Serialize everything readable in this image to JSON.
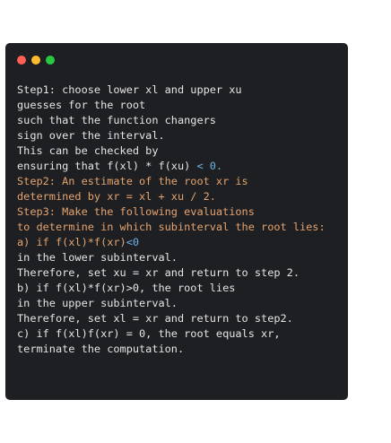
{
  "window": {
    "background": "#1e1f22",
    "controls": [
      {
        "name": "close",
        "color": "#ff5f56"
      },
      {
        "name": "minimize",
        "color": "#ffbd2e"
      },
      {
        "name": "maximize",
        "color": "#27c93f"
      }
    ]
  },
  "colors": {
    "default": "#e6e6e6",
    "orange": "#e5a46f",
    "blue": "#6fb3e6"
  },
  "lines": [
    [
      {
        "text": "Step1: choose lower xl and upper xu",
        "color": "default"
      }
    ],
    [
      {
        "text": "guesses for the root",
        "color": "default"
      }
    ],
    [
      {
        "text": "such that the function changers",
        "color": "default"
      }
    ],
    [
      {
        "text": "sign over the interval.",
        "color": "default"
      }
    ],
    [
      {
        "text": "This can be checked by",
        "color": "default"
      }
    ],
    [
      {
        "text": "ensuring that f(xl) * f(xu) ",
        "color": "default"
      },
      {
        "text": "< 0.",
        "color": "blue"
      }
    ],
    [
      {
        "text": "Step2: An estimate of the root xr is",
        "color": "orange"
      }
    ],
    [
      {
        "text": "determined by xr = xl + xu / 2.",
        "color": "orange"
      }
    ],
    [
      {
        "text": "Step3: Make the following evaluations",
        "color": "orange"
      }
    ],
    [
      {
        "text": "to determine in which subinterval the root lies:",
        "color": "orange"
      }
    ],
    [
      {
        "text": "a) if f(xl)*f(xr)",
        "color": "orange"
      },
      {
        "text": "<0",
        "color": "blue"
      }
    ],
    [
      {
        "text": "in the lower subinterval.",
        "color": "default"
      }
    ],
    [
      {
        "text": "Therefore, set xu = xr and return to step 2.",
        "color": "default"
      }
    ],
    [
      {
        "text": "b) if f(xl)*f(xr)>0, the root lies",
        "color": "default"
      }
    ],
    [
      {
        "text": "in the upper subinterval.",
        "color": "default"
      }
    ],
    [
      {
        "text": "Therefore, set xl = xr and return to step2.",
        "color": "default"
      }
    ],
    [
      {
        "text": "c) if f(xl)f(xr) = 0, the root equals xr,",
        "color": "default"
      }
    ],
    [
      {
        "text": "terminate the computation.",
        "color": "default"
      }
    ]
  ]
}
